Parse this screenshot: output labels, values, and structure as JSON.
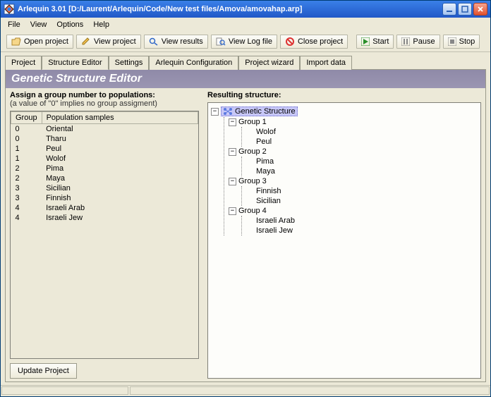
{
  "window": {
    "title": "Arlequin 3.01 [D:/Laurent/Arlequin/Code/New test files/Amova/amovahap.arp]"
  },
  "menu": {
    "file": "File",
    "view": "View",
    "options": "Options",
    "help": "Help"
  },
  "toolbar": {
    "open": "Open project",
    "viewp": "View project",
    "results": "View results",
    "log": "View Log file",
    "close": "Close project",
    "start": "Start",
    "pause": "Pause",
    "stop": "Stop"
  },
  "tabs": {
    "project": "Project",
    "structure": "Structure Editor",
    "settings": "Settings",
    "config": "Arlequin Configuration",
    "wizard": "Project wizard",
    "import": "Import data"
  },
  "page_title": "Genetic Structure Editor",
  "left": {
    "heading": "Assign a group number to populations:",
    "subheading": "(a value of \"0\" implies no group assigment)",
    "col_group": "Group",
    "col_pop": "Population samples",
    "rows": [
      {
        "g": "0",
        "p": "Oriental"
      },
      {
        "g": "0",
        "p": "Tharu"
      },
      {
        "g": "1",
        "p": "Peul"
      },
      {
        "g": "1",
        "p": "Wolof"
      },
      {
        "g": "2",
        "p": "Pima"
      },
      {
        "g": "2",
        "p": "Maya"
      },
      {
        "g": "3",
        "p": "Sicilian"
      },
      {
        "g": "3",
        "p": "Finnish"
      },
      {
        "g": "4",
        "p": "Israeli Arab"
      },
      {
        "g": "4",
        "p": "Israeli Jew"
      }
    ],
    "update": "Update Project"
  },
  "right": {
    "heading": "Resulting structure:",
    "root": "Genetic Structure",
    "groups": [
      {
        "name": "Group 1",
        "items": [
          "Wolof",
          "Peul"
        ]
      },
      {
        "name": "Group 2",
        "items": [
          "Pima",
          "Maya"
        ]
      },
      {
        "name": "Group 3",
        "items": [
          "Finnish",
          "Sicilian"
        ]
      },
      {
        "name": "Group 4",
        "items": [
          "Israeli Arab",
          "Israeli Jew"
        ]
      }
    ]
  }
}
